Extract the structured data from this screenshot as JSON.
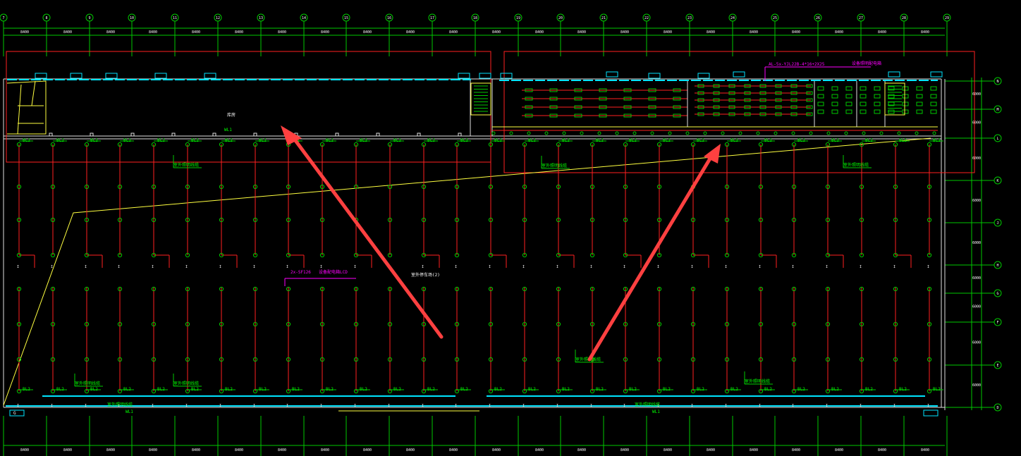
{
  "drawing": {
    "background_color": "#000000",
    "colors": {
      "grid_green": "#00c800",
      "circuit_red": "#ff2020",
      "bus_cyan": "#00e5ff",
      "route_yellow": "#ffff40",
      "note_magenta": "#ff00ff",
      "arrow_red": "#ff4040",
      "wall_white": "#e0e0e0"
    },
    "top_axis_labels": [
      "7",
      "8",
      "9",
      "10",
      "11",
      "12",
      "13",
      "14",
      "15",
      "16",
      "17",
      "18",
      "19",
      "20",
      "21",
      "22",
      "23",
      "24",
      "25",
      "26",
      "27",
      "28",
      "29"
    ],
    "right_axis_labels": [
      "N",
      "M",
      "L",
      "K",
      "J",
      "H",
      "G",
      "F",
      "E",
      "D"
    ],
    "dimension_label": "8400",
    "right_dimension_label": "6000",
    "fixture_tag": "BL2",
    "fixture_sub": "24x2",
    "room_label": "库房",
    "hall_label": "室外停车场(2)",
    "magenta_note_left": "2x-SF126",
    "magenta_note_left_sub": "设备配电箱LCD",
    "magenta_note_right": "AL-5x-YJL22B-4*16+2X25",
    "magenta_note_right_sub": "设备照明配电箱",
    "green_note": "室外照明线缆",
    "bottom_left_tag": "G",
    "cable_tag": "WL1",
    "arrows": [
      {
        "name": "left-arrow",
        "points_to": "room-left-area"
      },
      {
        "name": "right-arrow",
        "points_to": "fixture-row-top-right"
      }
    ]
  }
}
